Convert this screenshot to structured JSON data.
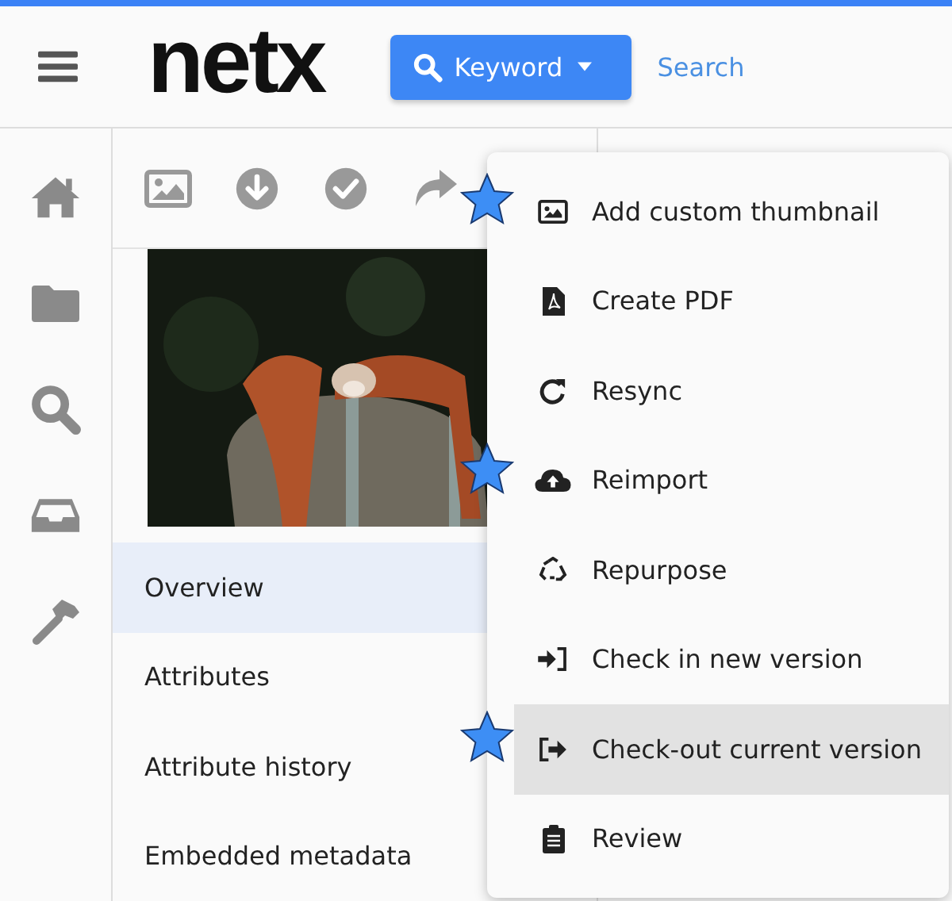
{
  "header": {
    "logo": "netx",
    "search_mode_button": {
      "label": "Keyword"
    },
    "search_link": "Search"
  },
  "nav": [
    {
      "label": "Overview",
      "selected": true
    },
    {
      "label": "Attributes",
      "selected": false
    },
    {
      "label": "Attribute history",
      "selected": false
    },
    {
      "label": "Embedded metadata",
      "selected": false
    }
  ],
  "menu": [
    {
      "label": "Add custom thumbnail",
      "selected": false,
      "starred": true
    },
    {
      "label": "Create PDF",
      "selected": false,
      "starred": false
    },
    {
      "label": "Resync",
      "selected": false,
      "starred": false
    },
    {
      "label": "Reimport",
      "selected": false,
      "starred": true
    },
    {
      "label": "Repurpose",
      "selected": false,
      "starred": false
    },
    {
      "label": "Check in new version",
      "selected": false,
      "starred": false
    },
    {
      "label": "Check-out current version",
      "selected": true,
      "starred": true
    },
    {
      "label": "Review",
      "selected": false,
      "starred": false
    }
  ]
}
